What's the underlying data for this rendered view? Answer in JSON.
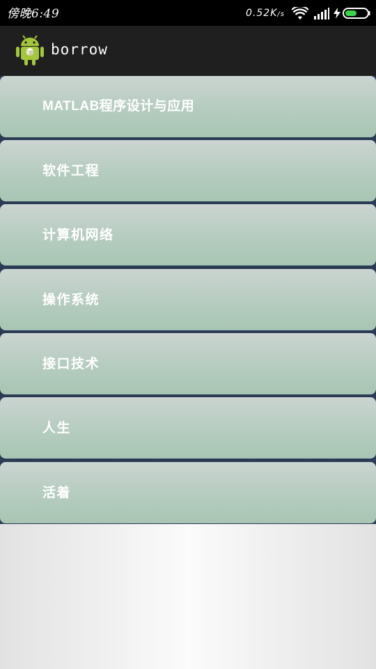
{
  "status_bar": {
    "time": "傍晚6:49",
    "net_speed": "0.52K",
    "net_speed_unit": "/s",
    "icons": [
      "wifi-icon",
      "signal-icon",
      "charging-icon",
      "battery-icon"
    ],
    "battery_color": "#3bd34a"
  },
  "action_bar": {
    "title": "borrow",
    "icon": "android-icon"
  },
  "list": {
    "items": [
      {
        "label": "MATLAB程序设计与应用"
      },
      {
        "label": "软件工程"
      },
      {
        "label": "计算机网络"
      },
      {
        "label": "操作系统"
      },
      {
        "label": "接口技术"
      },
      {
        "label": "人生"
      },
      {
        "label": "活着"
      }
    ]
  },
  "colors": {
    "action_bar": "#1f1f1f",
    "list_divider": "#2b3a55",
    "item_top": "#cbd4d1",
    "item_bottom": "#a8c5b3"
  }
}
